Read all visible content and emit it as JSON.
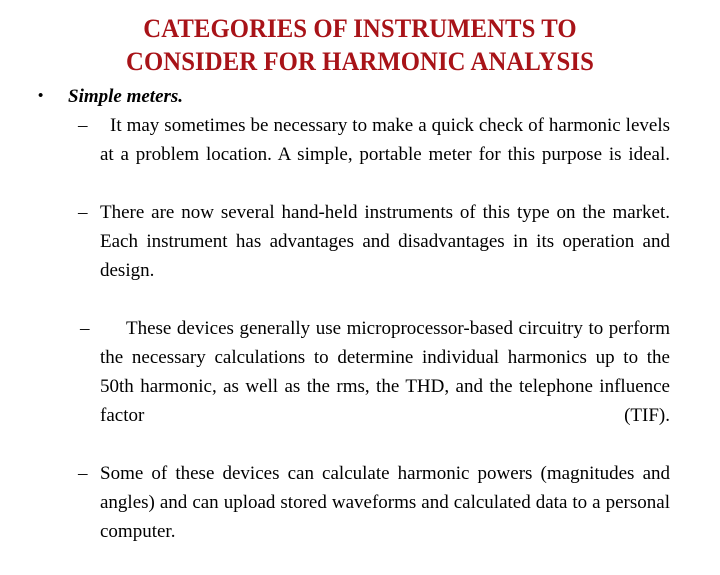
{
  "slide": {
    "background_color": "#ffffff",
    "title": {
      "color": "#a81318",
      "lines": [
        "CATEGORIES OF INSTRUMENTS TO",
        "CONSIDER FOR HARMONIC ANALYSIS"
      ]
    },
    "body": {
      "text_color": "#000000",
      "level1_marker": "•",
      "level2_marker": "–",
      "items": [
        {
          "level": 1,
          "text": "Simple meters.",
          "style": "bold-italic"
        },
        {
          "level": 2,
          "text": "It may sometimes be necessary to make a quick check of harmonic levels at a problem location. A simple, portable meter for this purpose is ideal."
        },
        {
          "level": 2,
          "text": "There are now several hand-held instruments of this type on the market. Each instrument has advantages and disadvantages in its operation and design."
        },
        {
          "level": 2,
          "text": "These devices generally use microprocessor-based circuitry to perform the necessary calculations to determine individual harmonics up to the 50th harmonic, as well as the rms, the THD, and the telephone influence factor (TIF)."
        },
        {
          "level": 2,
          "text": "Some of these devices can calculate harmonic powers (magnitudes and angles) and can upload stored waveforms and calculated data to a personal computer."
        }
      ]
    }
  }
}
